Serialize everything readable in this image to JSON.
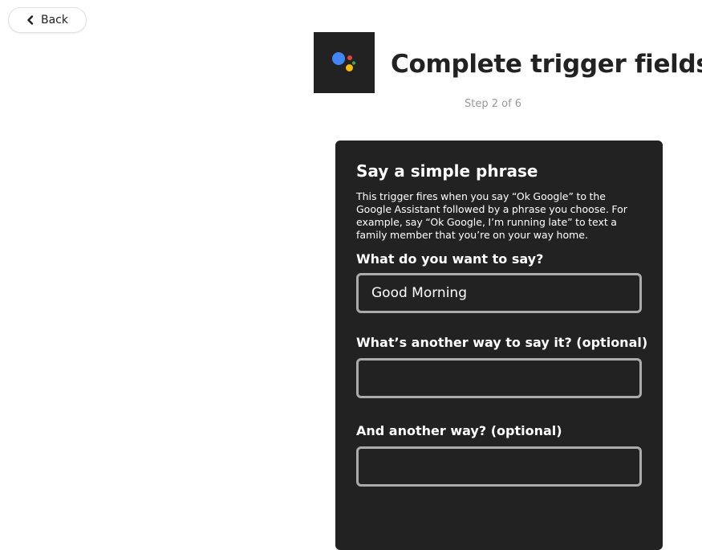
{
  "nav": {
    "back_label": "Back"
  },
  "header": {
    "title": "Complete trigger fields",
    "step": "Step 2 of 6",
    "service_icon": "google-assistant-icon",
    "logo_colors": {
      "blue": "#4285F4",
      "red": "#EA4335",
      "yellow": "#FBBC05",
      "green": "#34A853"
    }
  },
  "trigger": {
    "title": "Say a simple phrase",
    "description": "This trigger fires when you say “Ok Google” to the Google Assistant followed by a phrase you choose. For example, say “Ok Google, I’m running late” to text a family member that you’re on your way home.",
    "fields": [
      {
        "label": "What do you want to say?",
        "value": "Good Morning",
        "placeholder": ""
      },
      {
        "label": "What’s another way to say it? (optional)",
        "value": "",
        "placeholder": ""
      },
      {
        "label": "And another way? (optional)",
        "value": "",
        "placeholder": ""
      }
    ]
  },
  "colors": {
    "card_background": "#222222",
    "field_border": "#ababab",
    "step_text": "#999999"
  }
}
